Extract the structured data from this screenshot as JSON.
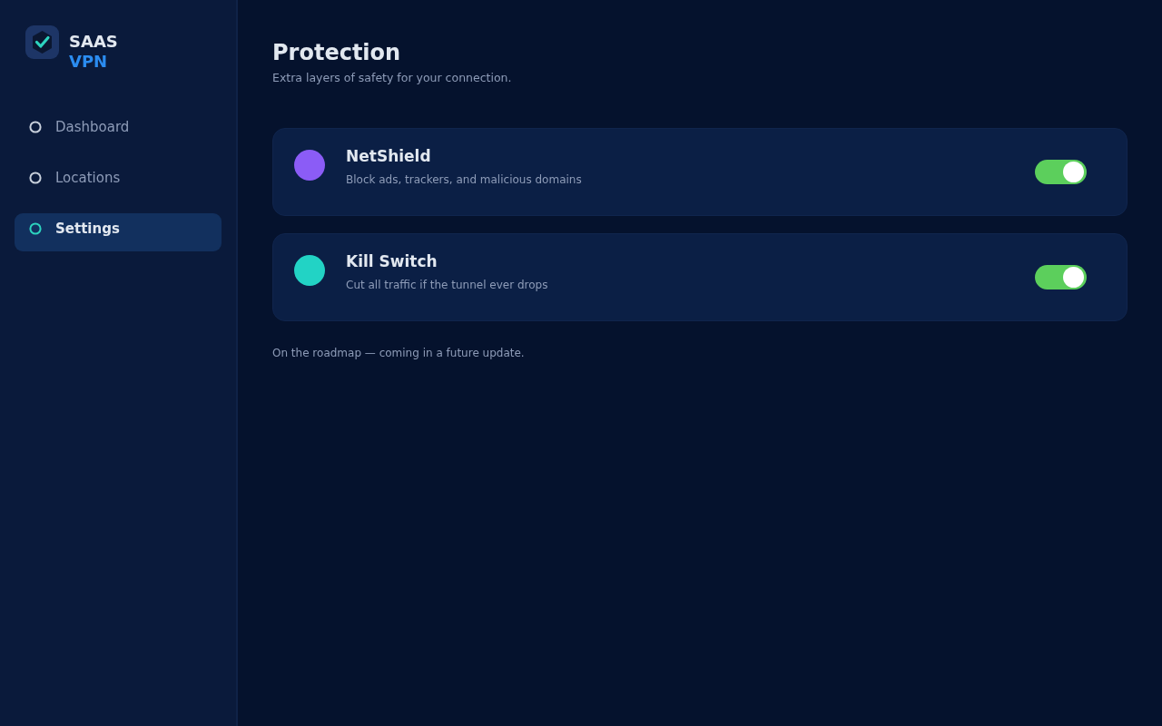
{
  "brand": {
    "line_1": "SAAS",
    "line_2": "VPN"
  },
  "sidebar": {
    "items": [
      {
        "label": "Dashboard",
        "selected": false
      },
      {
        "label": "Locations",
        "selected": false
      },
      {
        "label": "Settings",
        "selected": true
      }
    ]
  },
  "page": {
    "title": "Protection",
    "subtitle": "Extra layers of safety for your connection."
  },
  "features": [
    {
      "name": "NetShield",
      "description": "Block ads, trackers, and malicious domains",
      "color": "#8b5cf6",
      "on": true
    },
    {
      "name": "Kill Switch",
      "description": "Cut all traffic if the tunnel ever drops",
      "color": "#22d3c5",
      "on": true
    }
  ],
  "note": "On the roadmap — coming in a future update."
}
